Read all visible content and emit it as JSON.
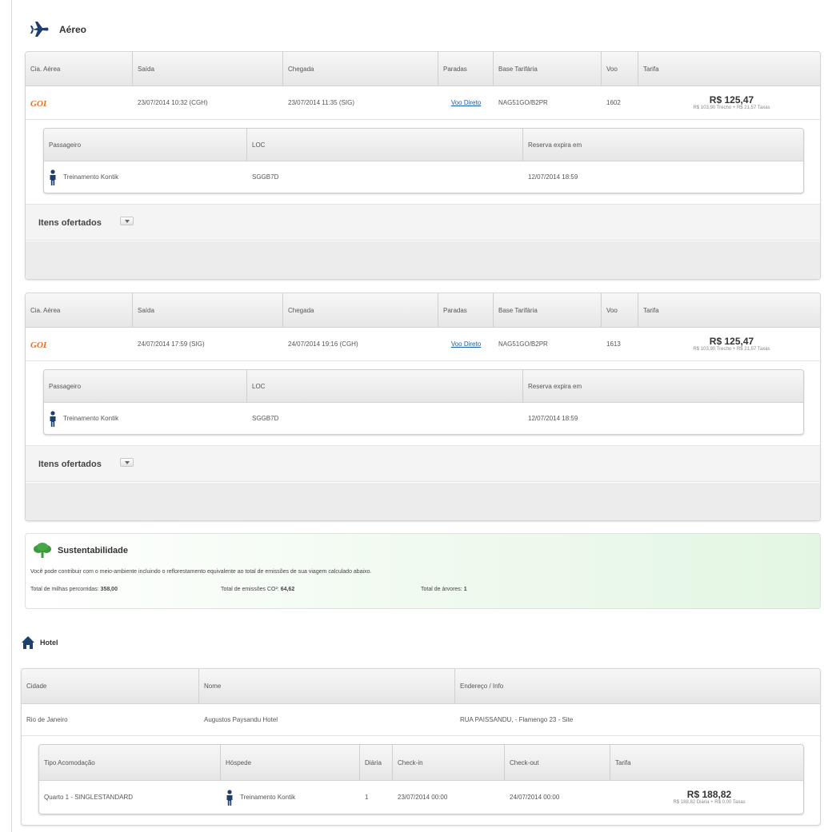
{
  "air": {
    "title": "Aéreo",
    "headers": {
      "airline": "Cia. Aérea",
      "departure": "Saída",
      "arrival": "Chegada",
      "stops": "Paradas",
      "fare_basis": "Base Tarifária",
      "flight": "Voo",
      "fare": "Tarifa"
    },
    "pax_headers": {
      "passenger": "Passageiro",
      "loc": "LOC",
      "expires": "Reserva expira em"
    },
    "offers_label": "Itens ofertados",
    "flights": [
      {
        "airline_icon": "gol-airline-logo",
        "departure": "23/07/2014 10:32 (CGH)",
        "arrival": "23/07/2014 11:35 (SIG)",
        "stops": "Voo Direto",
        "fare_basis": "NAG51GO/B2PR",
        "flight": "1602",
        "price": "R$ 125,47",
        "price_detail": "R$ 103,90 Trecho + R$ 21,57 Taxas",
        "passenger": {
          "name": "Treinamento Kontik",
          "loc": "SGGB7D",
          "expires": "12/07/2014 18:59"
        }
      },
      {
        "airline_icon": "gol-airline-logo",
        "departure": "24/07/2014 17:59 (SIG)",
        "arrival": "24/07/2014 19:16 (CGH)",
        "stops": "Voo Direto",
        "fare_basis": "NAG51GO/B2PR",
        "flight": "1613",
        "price": "R$ 125,47",
        "price_detail": "R$ 103,90 Trecho + R$ 21,57 Taxas",
        "passenger": {
          "name": "Treinamento Kontik",
          "loc": "SGGB7D",
          "expires": "12/07/2014 18:59"
        }
      }
    ]
  },
  "sustain": {
    "title": "Sustentabilidade",
    "description": "Você pode contribuir com o meio-ambiente incluindo o reflorestamento equivalente ao total de emissões de sua viagem calculado abaixo.",
    "miles_label": "Total de milhas percorridas:",
    "miles_value": "358,00",
    "emissions_label": "Total de emissões CO²:",
    "emissions_value": "64,62",
    "trees_label": "Total de árvores:",
    "trees_value": "1"
  },
  "hotel": {
    "title": "Hotel",
    "headers": {
      "city": "Cidade",
      "name": "Nome",
      "address": "Endereço / Info"
    },
    "city": "Rio de Janeiro",
    "name": "Augustos Paysandu Hotel",
    "address": "RUA PAISSANDU, - Flamengo 23 - Site",
    "room_headers": {
      "type": "Tipo Acomodação",
      "guest": "Hóspede",
      "nights": "Diária",
      "checkin": "Check-in",
      "checkout": "Check-out",
      "fare": "Tarifa"
    },
    "room": {
      "type": "Quarto 1 - SINGLESTANDARD",
      "guest": "Treinamento Kontik",
      "nights": "1",
      "checkin": "23/07/2014 00:00",
      "checkout": "24/07/2014 00:00",
      "price": "R$ 188,82",
      "price_detail": "R$ 188,82 Diária + R$ 0,00 Taxas"
    }
  },
  "colors": {
    "primary_blue": "#1e3e6e",
    "gol_orange": "#f26b22",
    "tree_green": "#3c9a3c",
    "link_blue": "#1a5fa8"
  }
}
